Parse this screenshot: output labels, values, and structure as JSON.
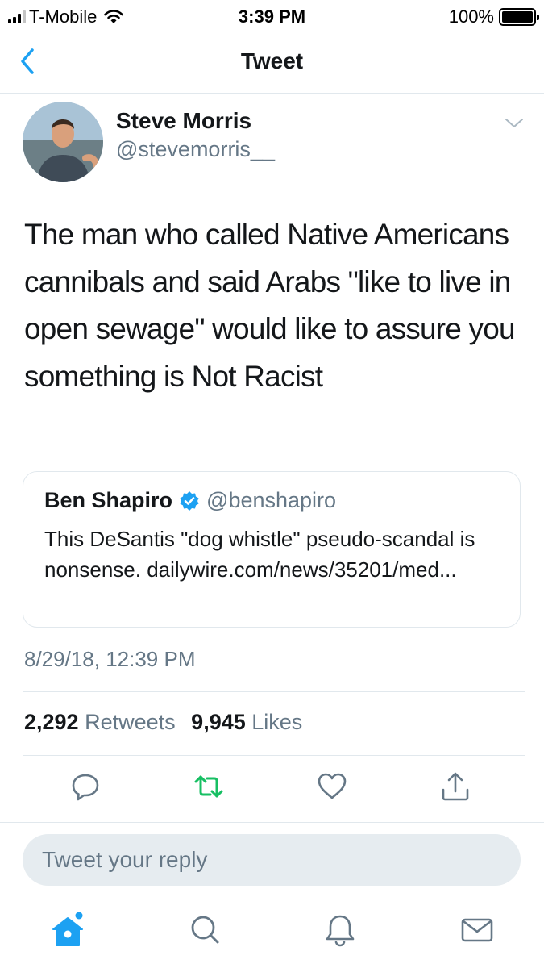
{
  "status_bar": {
    "carrier": "T-Mobile",
    "time": "3:39 PM",
    "battery": "100%",
    "battery_level": 1.0,
    "signal_bars_filled": 3,
    "signal_bars_total": 4
  },
  "nav": {
    "title": "Tweet",
    "back_icon": "chevron-left-icon"
  },
  "tweet": {
    "author_name": "Steve Morris",
    "author_handle": "@stevemorris__",
    "text": "The man who called Native Americans cannibals and said Arabs \"like to live in open sewage\" would like to assure you something is Not Racist",
    "timestamp": "8/29/18, 12:39 PM",
    "retweets_count": "2,292",
    "retweets_label": "Retweets",
    "likes_count": "9,945",
    "likes_label": "Likes"
  },
  "quote": {
    "author_name": "Ben Shapiro",
    "author_handle": "@benshapiro",
    "text": "This DeSantis \"dog whistle\" pseudo-scandal is nonsense. dailywire.com/news/35201/med..."
  },
  "reply": {
    "placeholder": "Tweet your reply"
  },
  "colors": {
    "accent": "#1da1f2",
    "retweet": "#17bf63",
    "text": "#14171a",
    "secondary": "#657786",
    "border": "#e1e8ed"
  },
  "actions": [
    "reply-icon",
    "retweet-icon",
    "like-icon",
    "share-icon"
  ],
  "tabs": [
    "home-icon",
    "search-icon",
    "notifications-icon",
    "messages-icon"
  ]
}
